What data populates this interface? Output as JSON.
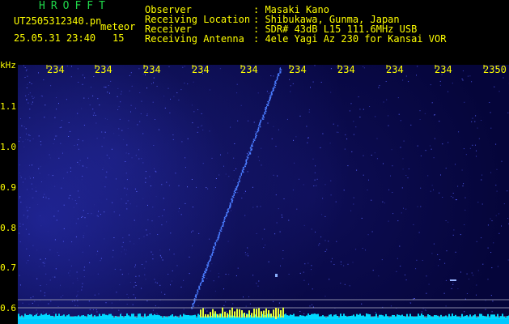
{
  "header": {
    "app_title": "HROFFT",
    "filename": "UT2505312340.pn",
    "mode": "meteor",
    "datetime": "25.05.31 23:40",
    "count": "15",
    "observer_label": "Observer",
    "observer_value": ": Masaki Kano",
    "location_label": "Receiving Location",
    "location_value": ": Shibukawa, Gunma, Japan",
    "receiver_label": "Receiver",
    "receiver_value": ": SDR# 43dB L15 111.6MHz USB",
    "antenna_label": "Receiving Antenna",
    "antenna_value": ": 4ele Yagi Az 230 for Kansai VOR"
  },
  "axes": {
    "y_unit": "kHz",
    "x_ticks": [
      "234",
      "234",
      "234",
      "234",
      "234",
      "234",
      "234",
      "234",
      "234",
      "2350"
    ],
    "y_ticks": [
      "1.1",
      "1.0",
      "0.9",
      "0.8",
      "0.7",
      "0.6"
    ]
  },
  "colors": {
    "text": "#ffff00",
    "title": "#1fd84a",
    "background": "#05053a",
    "meteor_trace": "#3a6cff",
    "baseline": "#00d8ff"
  }
}
